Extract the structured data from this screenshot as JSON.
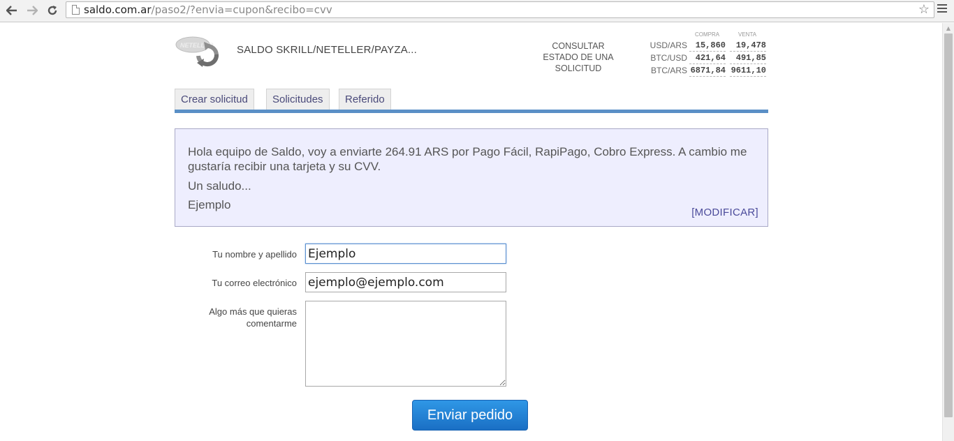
{
  "browser": {
    "url_host": "saldo.com.ar",
    "url_path": "/paso2/?envia=cupon&recibo=cvv",
    "back_icon": "arrow-left-icon",
    "forward_icon": "arrow-right-icon",
    "reload_icon": "reload-icon",
    "star_icon": "star-icon",
    "menu_icon": "hamburger-menu-icon"
  },
  "header": {
    "site_title": "SALDO SKRILL/NETELLER/PAYZA...",
    "consultar": "CONSULTAR ESTADO DE UNA SOLICITUD"
  },
  "rates": {
    "col_buy": "COMPRA",
    "col_sell": "VENTA",
    "rows": [
      {
        "pair": "USD/ARS",
        "buy": "15,860",
        "sell": "19,478"
      },
      {
        "pair": "BTC/USD",
        "buy": "421,64",
        "sell": "491,85"
      },
      {
        "pair": "BTC/ARS",
        "buy": "6871,84",
        "sell": "9611,10"
      }
    ]
  },
  "tabs": [
    {
      "label": "Crear solicitud"
    },
    {
      "label": "Solicitudes"
    },
    {
      "label": "Referido"
    }
  ],
  "message": {
    "line1": "Hola equipo de Saldo, voy a enviarte 264.91 ARS por Pago Fácil, RapiPago, Cobro Express. A cambio me gustaría recibir una tarjeta y su CVV.",
    "line2": "Un saludo...",
    "line3": "Ejemplo",
    "modify_link": "[MODIFICAR]"
  },
  "form": {
    "name_label": "Tu nombre y apellido",
    "name_value": "Ejemplo",
    "email_label": "Tu correo electrónico",
    "email_value": "ejemplo@ejemplo.com",
    "comment_label": "Algo más que quieras comentarme",
    "comment_value": "",
    "submit_label": "Enviar pedido"
  },
  "colors": {
    "tab_bar": "#5a8fc6",
    "message_bg": "#eeeefe",
    "button": "#1a7fd4"
  }
}
